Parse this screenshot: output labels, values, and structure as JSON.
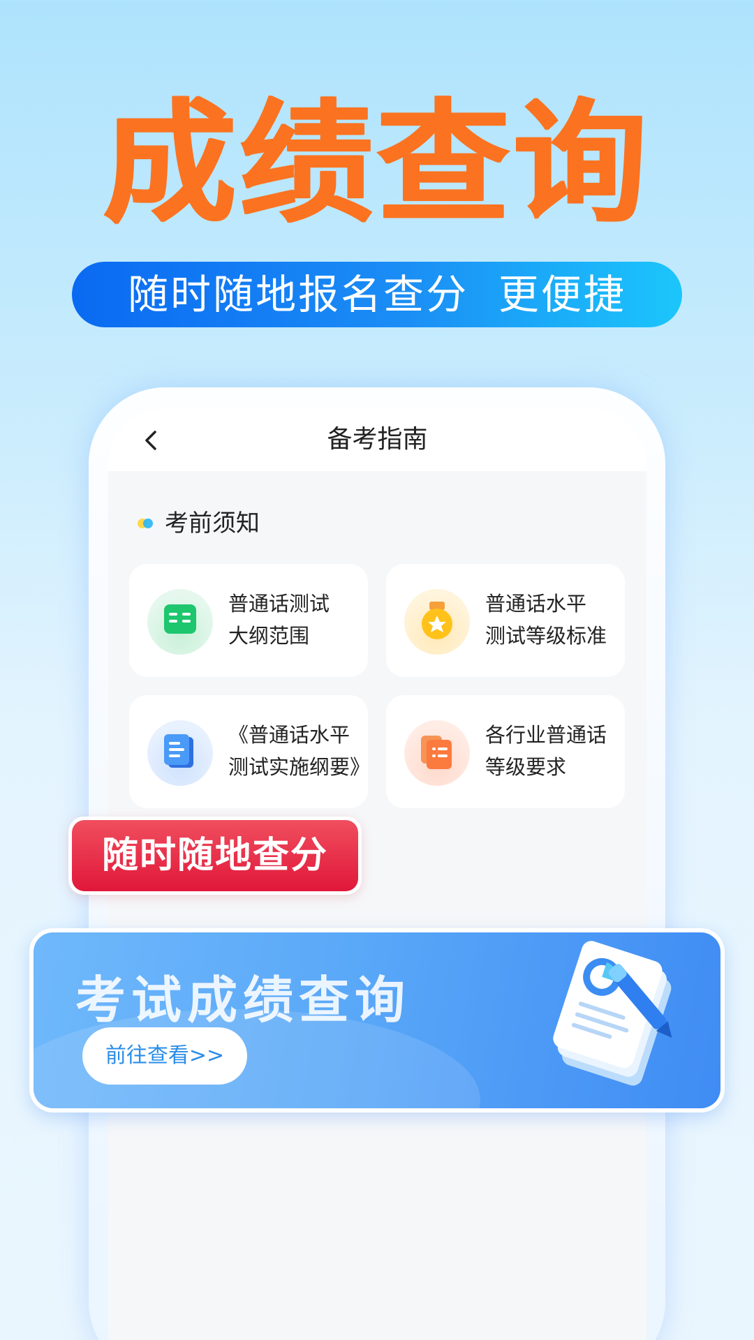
{
  "hero": {
    "title": "成绩查询",
    "slogan": "随时随地报名查分  更便捷"
  },
  "app": {
    "nav_title": "备考指南",
    "section_title": "考前须知",
    "cards": [
      {
        "label": "普通话测试\n大纲范围",
        "icon": "book-icon",
        "color": "#1ec66e"
      },
      {
        "label": "普通话水平\n测试等级标准",
        "icon": "medal-icon",
        "color": "#ffc21a"
      },
      {
        "label": "《普通话水平\n测试实施纲要》",
        "icon": "document-icon",
        "color": "#3d8ff5"
      },
      {
        "label": "各行业普通话\n等级要求",
        "icon": "checklist-icon",
        "color": "#fb7a3e"
      }
    ]
  },
  "badge": {
    "text": "随时随地查分"
  },
  "banner": {
    "title": "考试成绩查询",
    "button": "前往查看>>"
  },
  "colors": {
    "accent_orange": "#fb7320",
    "slogan_blue": "#0a6af2",
    "badge_red": "#e0173a",
    "banner_blue": "#4f9ff6"
  }
}
